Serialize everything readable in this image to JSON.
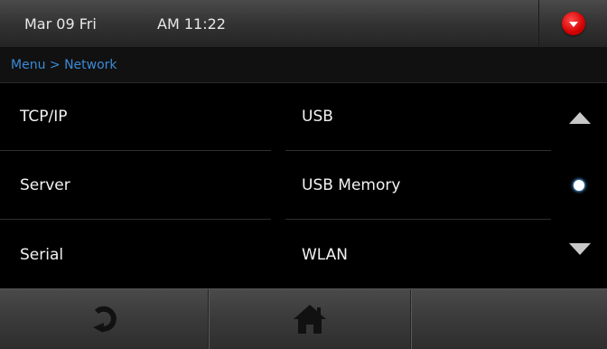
{
  "status_bar": {
    "date": "Mar 09 Fri",
    "time": "AM 11:22",
    "menu_button_icon": "dropdown-circle-icon",
    "menu_button_color": "#d40000"
  },
  "breadcrumb": {
    "text": "Menu > Network",
    "color": "#3a8ad6"
  },
  "menu": {
    "left_items": [
      {
        "label": "TCP/IP"
      },
      {
        "label": "Server"
      },
      {
        "label": "Serial"
      }
    ],
    "right_items": [
      {
        "label": "USB"
      },
      {
        "label": "USB Memory"
      },
      {
        "label": "WLAN"
      }
    ]
  },
  "scroll": {
    "up_icon": "scroll-up-arrow-icon",
    "indicator_icon": "page-indicator-dot-icon",
    "down_icon": "scroll-down-arrow-icon",
    "current_page": 1,
    "total_pages": 1
  },
  "bottom_bar": {
    "buttons": [
      {
        "icon": "refresh-icon"
      },
      {
        "icon": "home-icon"
      },
      {
        "icon": ""
      }
    ]
  }
}
